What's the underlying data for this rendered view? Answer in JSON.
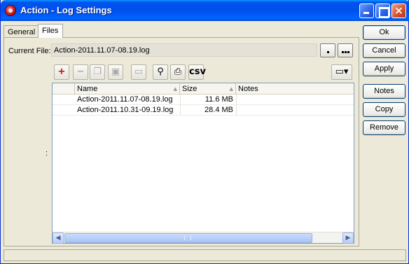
{
  "window": {
    "title": "Action - Log Settings"
  },
  "tabs": [
    {
      "label": "General"
    },
    {
      "label": "Files"
    }
  ],
  "current_file": {
    "label": "Current File:",
    "value": "Action-2011.11.07-08.19.log"
  },
  "toolbar": {
    "icons": [
      "add-icon",
      "remove-icon",
      "copy-icon",
      "paste-icon",
      "comment-icon",
      "find-icon",
      "print-icon",
      "csv-icon",
      "columns-icon"
    ],
    "csv_label": "csv"
  },
  "table": {
    "columns": [
      "Name",
      "Size",
      "Notes"
    ],
    "rows": [
      {
        "name": "Action-2011.11.07-08.19.log",
        "size": "11.6 MB",
        "notes": ""
      },
      {
        "name": "Action-2011.10.31-09.19.log",
        "size": "28.4 MB",
        "notes": ""
      }
    ]
  },
  "side_label": ":",
  "buttons": {
    "ok": "Ok",
    "cancel": "Cancel",
    "apply": "Apply",
    "notes": "Notes",
    "copy": "Copy",
    "remove": "Remove"
  },
  "colors": {
    "titlebar": "#0053ee",
    "add_icon": "#d00000"
  }
}
